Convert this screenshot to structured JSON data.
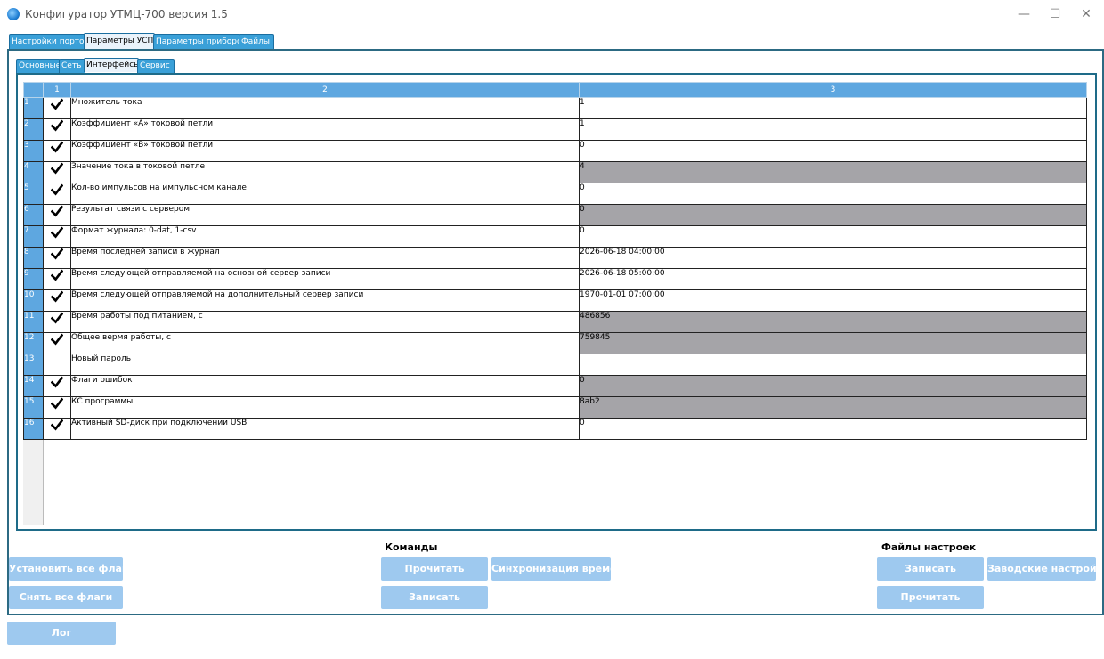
{
  "window": {
    "title": "Конфигуратор УТМЦ-700 версия 1.5",
    "controls": {
      "minimize": "—",
      "maximize": "☐",
      "close": "✕"
    }
  },
  "outer_tabs": [
    "Настройки портов",
    "Параметры УСПД",
    "Параметры приборов",
    "Файлы"
  ],
  "outer_active": 1,
  "inner_tabs": [
    "Основные",
    "Сеть",
    "Интерфейсы",
    "Сервис"
  ],
  "inner_active": 3,
  "grid": {
    "headers": [
      "1",
      "2",
      "3"
    ],
    "rows": [
      {
        "num": "1",
        "checked": true,
        "name": "Множитель тока",
        "value": "1",
        "readonly": false
      },
      {
        "num": "2",
        "checked": true,
        "name": "Коэффициент «А» токовой петли",
        "value": "1",
        "readonly": false
      },
      {
        "num": "3",
        "checked": true,
        "name": "Коэффициент «В» токовой петли",
        "value": "0",
        "readonly": false
      },
      {
        "num": "4",
        "checked": true,
        "name": "Значение тока в токовой петле",
        "value": "4",
        "readonly": true
      },
      {
        "num": "5",
        "checked": true,
        "name": "Кол-во импульсов на импульсном канале",
        "value": "0",
        "readonly": false
      },
      {
        "num": "6",
        "checked": true,
        "name": "Результат связи с сервером",
        "value": "0",
        "readonly": true
      },
      {
        "num": "7",
        "checked": true,
        "name": "Формат журнала: 0-dat, 1-csv",
        "value": "0",
        "readonly": false
      },
      {
        "num": "8",
        "checked": true,
        "name": "Время последней записи в журнал",
        "value": "2026-06-18 04:00:00",
        "readonly": false
      },
      {
        "num": "9",
        "checked": true,
        "name": "Время следующей отправляемой на основной сервер записи",
        "value": "2026-06-18 05:00:00",
        "readonly": false
      },
      {
        "num": "10",
        "checked": true,
        "name": "Время следующей отправляемой на дополнительный сервер записи",
        "value": "1970-01-01 07:00:00",
        "readonly": false
      },
      {
        "num": "11",
        "checked": true,
        "name": "Время работы под питанием, с",
        "value": "486856",
        "readonly": true
      },
      {
        "num": "12",
        "checked": true,
        "name": "Общее вермя работы, с",
        "value": "759845",
        "readonly": true
      },
      {
        "num": "13",
        "checked": false,
        "name": "Новый пароль",
        "value": "",
        "readonly": false
      },
      {
        "num": "14",
        "checked": true,
        "name": "Флаги ошибок",
        "value": "0",
        "readonly": true
      },
      {
        "num": "15",
        "checked": true,
        "name": "КС программы",
        "value": "8ab2",
        "readonly": true
      },
      {
        "num": "16",
        "checked": true,
        "name": "Активный SD-диск при подключении USB",
        "value": "0",
        "readonly": false
      }
    ]
  },
  "controls": {
    "commands_label": "Команды",
    "files_label": "Файлы настроек",
    "set_all_flags": "Установить все флаги",
    "clear_all_flags": "Снять все флаги",
    "cmd_read": "Прочитать",
    "cmd_sync_time": "Синхронизация времени",
    "cmd_write": "Записать",
    "file_write": "Записать",
    "file_factory": "Заводские настройки",
    "file_read": "Прочитать",
    "log": "Лог"
  },
  "colors": {
    "tab": "#3aa0d8",
    "header": "#5ea7e0",
    "button": "#9ec9ef",
    "readonly_cell": "#a5a4a8",
    "frame": "#2c6a83"
  }
}
